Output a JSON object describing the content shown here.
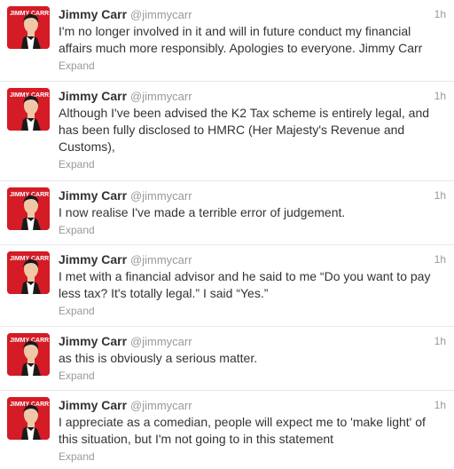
{
  "tweets": [
    {
      "name": "Jimmy Carr",
      "handle": "@jimmycarr",
      "time": "1h",
      "text": "I'm no longer involved in it and will in future conduct my financial affairs much more responsibly. Apologies to everyone. Jimmy Carr",
      "expand": "Expand",
      "avatar_text": "JIMMY CARR"
    },
    {
      "name": "Jimmy Carr",
      "handle": "@jimmycarr",
      "time": "1h",
      "text": "Although I've been advised the K2 Tax scheme is entirely legal, and has been fully disclosed to HMRC (Her Majesty's Revenue and Customs),",
      "expand": "Expand",
      "avatar_text": "JIMMY CARR"
    },
    {
      "name": "Jimmy Carr",
      "handle": "@jimmycarr",
      "time": "1h",
      "text": "I now realise I've made a terrible error of judgement.",
      "expand": "Expand",
      "avatar_text": "JIMMY CARR"
    },
    {
      "name": "Jimmy Carr",
      "handle": "@jimmycarr",
      "time": "1h",
      "text": "I met with a financial advisor and he said to me “Do you want to pay less tax? It's totally legal.” I said “Yes.”",
      "expand": "Expand",
      "avatar_text": "JIMMY CARR"
    },
    {
      "name": "Jimmy Carr",
      "handle": "@jimmycarr",
      "time": "1h",
      "text": "as this is obviously a serious matter.",
      "expand": "Expand",
      "avatar_text": "JIMMY CARR"
    },
    {
      "name": "Jimmy Carr",
      "handle": "@jimmycarr",
      "time": "1h",
      "text": "I appreciate as a comedian, people will expect me to 'make light' of this situation, but I'm not going to in this statement",
      "expand": "Expand",
      "avatar_text": "JIMMY CARR"
    }
  ],
  "colors": {
    "avatar_bg": "#d41b26",
    "text": "#333333",
    "muted": "#999999",
    "divider": "#e8e8e8"
  }
}
